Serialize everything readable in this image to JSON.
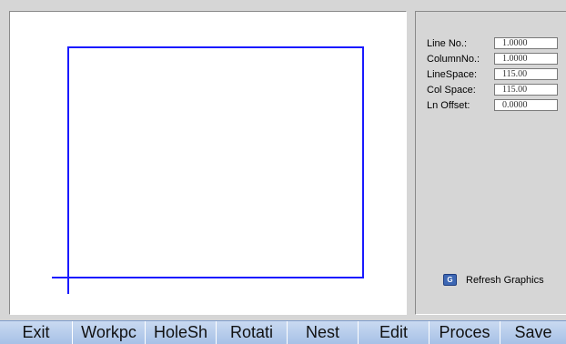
{
  "params": [
    {
      "label": "Line No.:",
      "value": "1.0000"
    },
    {
      "label": "ColumnNo.:",
      "value": "1.0000"
    },
    {
      "label": "LineSpace:",
      "value": "115.00"
    },
    {
      "label": "Col Space:",
      "value": "115.00"
    },
    {
      "label": "Ln Offset:",
      "value": "0.0000"
    }
  ],
  "refresh": {
    "icon_text": "G",
    "label": "Refresh Graphics"
  },
  "fkeys": [
    "Exit",
    "Workpc",
    "HoleSh",
    "Rotati",
    "Nest",
    "Edit",
    "Proces",
    "Save"
  ],
  "colors": {
    "drawing": "#1a1aff",
    "bar": "#b7cdec",
    "panel": "#d6d6d6"
  }
}
